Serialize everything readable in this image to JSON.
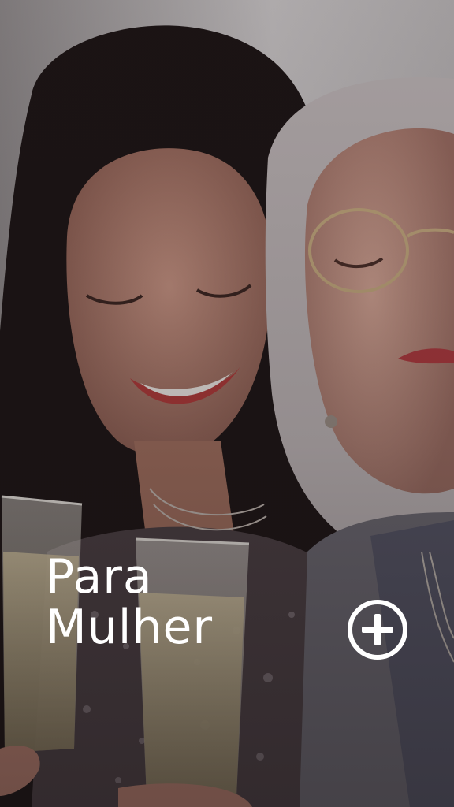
{
  "card": {
    "title_line1": "Para",
    "title_line2": "Mulher",
    "action_icon": "plus-circle-icon"
  },
  "colors": {
    "text": "#ffffff",
    "overlay": "#141012"
  }
}
